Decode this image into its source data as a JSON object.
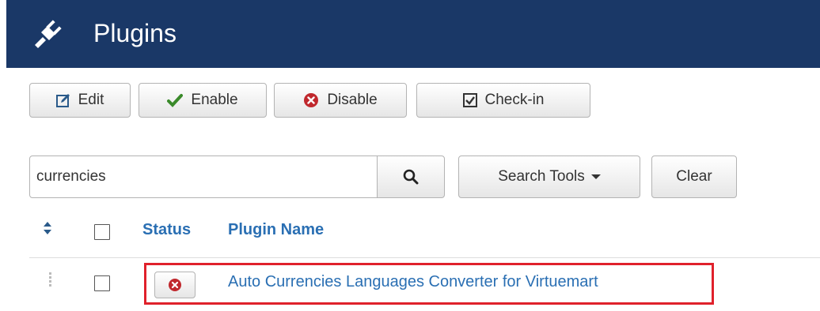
{
  "header": {
    "title": "Plugins",
    "icon": "plug-icon",
    "background": "#1a3867"
  },
  "toolbar": {
    "edit_label": "Edit",
    "enable_label": "Enable",
    "disable_label": "Disable",
    "checkin_label": "Check-in",
    "icons": [
      "edit-icon",
      "checkmark-icon",
      "x-circle-icon",
      "checkbox-icon"
    ]
  },
  "search": {
    "value": "currencies",
    "placeholder": "",
    "tools_label": "Search Tools",
    "clear_label": "Clear"
  },
  "table": {
    "columns": [
      "Status",
      "Plugin Name"
    ],
    "rows": [
      {
        "status": "disabled",
        "name": "Auto Currencies Languages Converter for Virtuemart"
      }
    ]
  },
  "colors": {
    "accent_link": "#2a6fb3",
    "disabled_red": "#c0282d",
    "enable_green": "#3a8a2a",
    "highlight_border": "#e0212b"
  }
}
